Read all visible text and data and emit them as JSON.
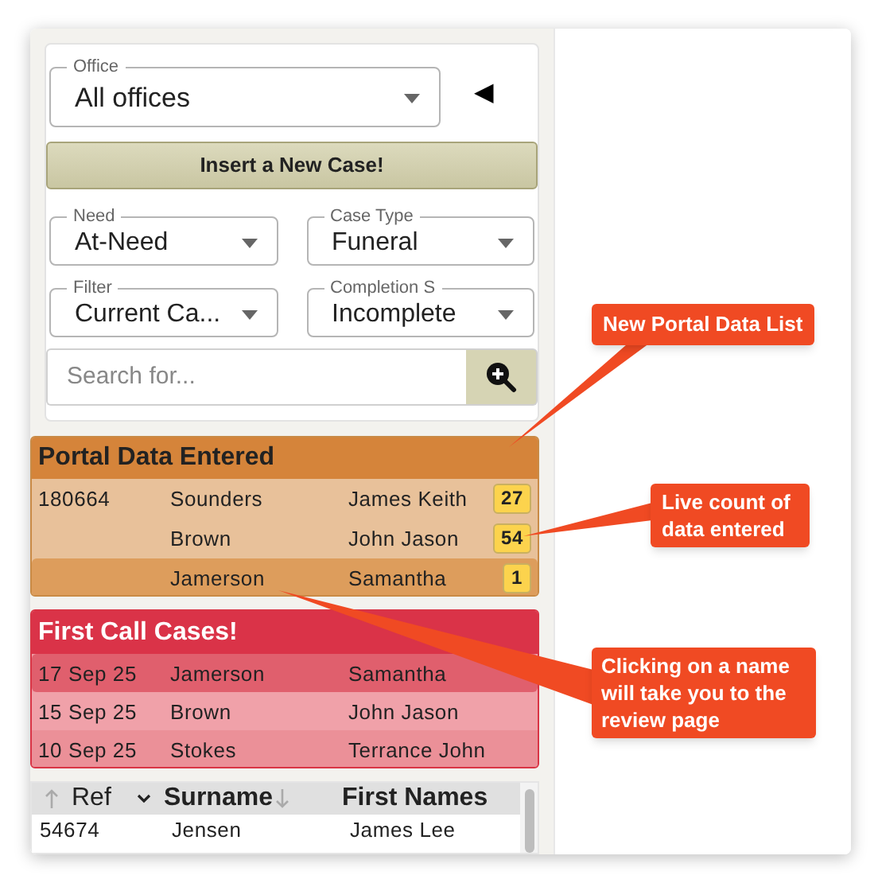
{
  "filters": {
    "office": {
      "label": "Office",
      "value": "All offices"
    },
    "collapse_toggle": "◀",
    "insert_button": "Insert a New Case!",
    "selects": [
      {
        "label": "Need",
        "value": "At-Need"
      },
      {
        "label": "Case Type",
        "value": "Funeral"
      },
      {
        "label": "Filter",
        "value": "Current Ca..."
      },
      {
        "label": "Completion S",
        "value": "Incomplete"
      }
    ],
    "search": {
      "placeholder": "Search for..."
    }
  },
  "portal_data": {
    "title": "Portal Data Entered",
    "rows": [
      {
        "ref": "180664",
        "surname": "Sounders",
        "first_names": "James Keith",
        "count": "27",
        "highlighted": false
      },
      {
        "surname": "Brown",
        "first_names": "John Jason",
        "count": "54",
        "highlighted": false
      },
      {
        "surname": "Jamerson",
        "first_names": "Samantha",
        "count": "1",
        "highlighted": true
      }
    ]
  },
  "first_call": {
    "title": "First Call Cases!",
    "rows": [
      {
        "date": "17 Sep 25",
        "surname": "Jamerson",
        "first_names": "Samantha",
        "highlighted": true
      },
      {
        "date": "15 Sep 25",
        "surname": "Brown",
        "first_names": "John Jason",
        "highlighted": false
      },
      {
        "date": "10 Sep 25",
        "surname": "Stokes",
        "first_names": "Terrance John",
        "highlighted": false
      }
    ]
  },
  "cases_table": {
    "columns": [
      "Ref",
      "Surname",
      "First Names"
    ],
    "rows": [
      [
        "54674",
        "Jensen",
        "James Lee"
      ]
    ]
  },
  "callouts": [
    "New Portal Data List",
    "Live count of data entered",
    "Clicking on a name will take you to the review page"
  ]
}
